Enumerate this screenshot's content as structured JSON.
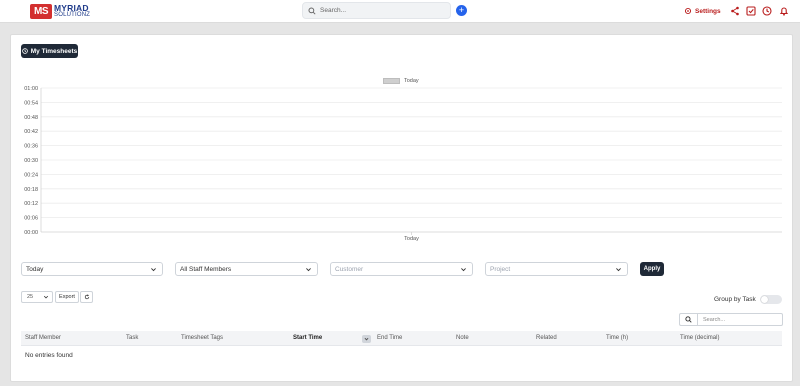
{
  "brand": {
    "logo_mark": "MS",
    "line1": "MYRIAD",
    "line2": "SOLUTIONZ"
  },
  "topbar": {
    "search_placeholder": "Search...",
    "plus_icon": "plus-icon",
    "settings_label": "Settings",
    "icons": [
      "share-icon",
      "checkbox-icon",
      "clock-icon",
      "bell-icon"
    ],
    "accent_color": "#b91c1c"
  },
  "page": {
    "my_timesheets_label": "My Timesheets"
  },
  "chart_data": {
    "type": "bar",
    "categories": [
      "Today"
    ],
    "series": [
      {
        "name": "Today",
        "values": [
          0
        ]
      }
    ],
    "y_ticks": [
      "00:00",
      "00:06",
      "00:12",
      "00:18",
      "00:24",
      "00:30",
      "00:36",
      "00:42",
      "00:48",
      "00:54",
      "01:00"
    ],
    "ylim": [
      0,
      60
    ],
    "grid": true,
    "legend": "top-center",
    "bar_color": "#cfcfcf"
  },
  "filters": {
    "date": "Today",
    "staff": "All Staff Members",
    "customer_placeholder": "Customer",
    "project_placeholder": "Project",
    "apply_label": "Apply"
  },
  "table_controls": {
    "page_length": "25",
    "export_label": "Export",
    "group_by_label": "Group by Task",
    "group_by_enabled": false,
    "search_placeholder": "Search..."
  },
  "table": {
    "columns": [
      "Staff Member",
      "Task",
      "Timesheet Tags",
      "Start Time",
      "End Time",
      "Note",
      "Related",
      "Time (h)",
      "Time (decimal)"
    ],
    "sorted_column": "Start Time",
    "empty_text": "No entries found",
    "rows": []
  }
}
